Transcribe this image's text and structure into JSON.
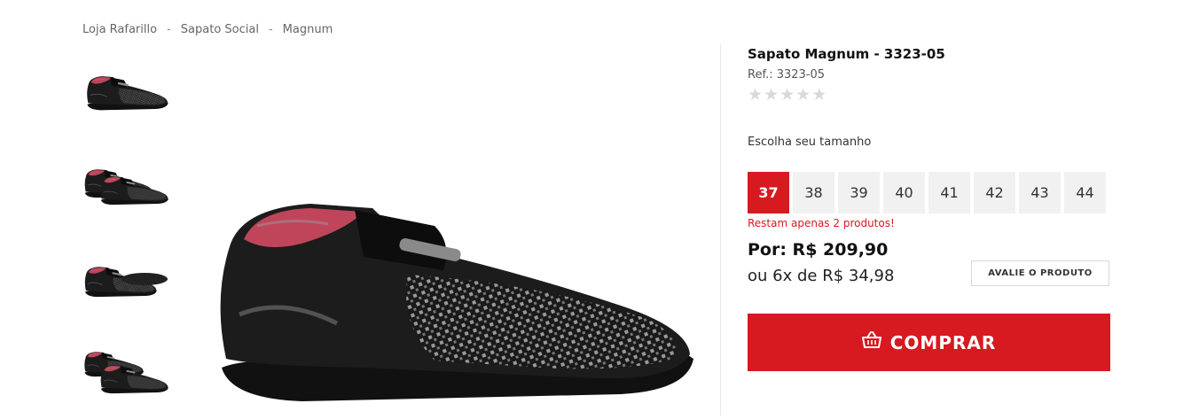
{
  "breadcrumb": {
    "items": [
      "Loja Rafarillo",
      "Sapato Social",
      "Magnum"
    ],
    "separator": "-"
  },
  "gallery": {
    "thumbnails": [
      "shoe-side-view",
      "shoe-pair-view",
      "shoe-sole-view",
      "shoe-top-view"
    ],
    "main_image": "shoe-main-view"
  },
  "product": {
    "title": "Sapato Magnum - 3323-05",
    "ref": "Ref.: 3323-05",
    "rating": {
      "value": 0,
      "max": 5,
      "star_glyph": "★"
    }
  },
  "sizes": {
    "label": "Escolha seu tamanho",
    "options": [
      "37",
      "38",
      "39",
      "40",
      "41",
      "42",
      "43",
      "44"
    ],
    "selected": "37",
    "stock_warning": "Restam apenas 2 produtos!"
  },
  "pricing": {
    "price": "Por: R$ 209,90",
    "installments": "ou 6x de R$ 34,98"
  },
  "actions": {
    "review_label": "AVALIE O PRODUTO",
    "buy_label": "COMPRAR",
    "buy_icon": "shopping-basket-icon"
  },
  "colors": {
    "accent": "#d71920",
    "size_bg": "#f1f1f1",
    "star_empty": "#d9d9d9"
  }
}
